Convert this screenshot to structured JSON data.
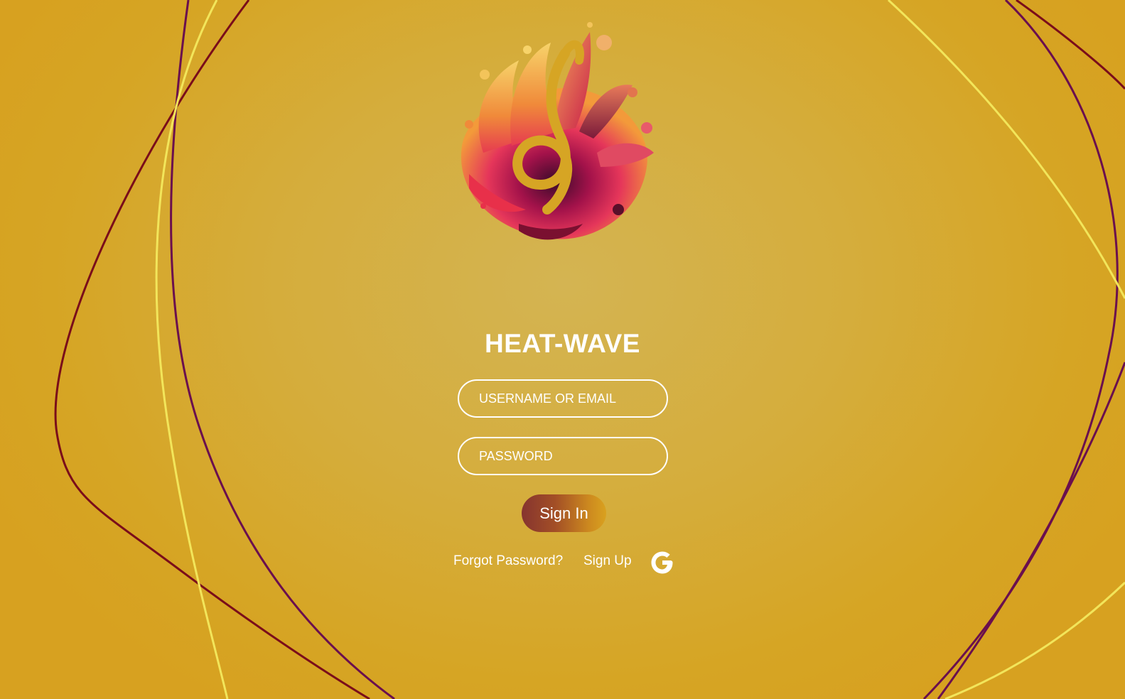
{
  "app": {
    "title": "HEAT-WAVE"
  },
  "form": {
    "username_placeholder": "USERNAME OR EMAIL",
    "username_value": "",
    "password_placeholder": "PASSWORD",
    "password_value": "",
    "signin_label": "Sign In"
  },
  "links": {
    "forgot_password": "Forgot Password?",
    "sign_up": "Sign Up"
  },
  "icons": {
    "logo": "flame-treble-clef-logo",
    "google": "google-icon"
  },
  "colors": {
    "background": "#d6a524",
    "text": "#ffffff",
    "line_maroon": "#7a0d1a",
    "line_purple": "#6a0f4e",
    "line_yellow": "#f2e55a",
    "button_start": "#86342f",
    "button_end": "#d9a11f"
  }
}
